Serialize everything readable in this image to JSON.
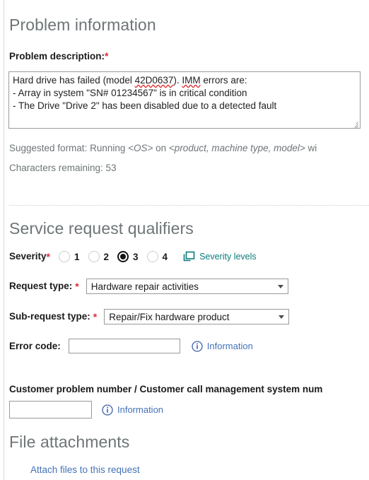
{
  "problem_information": {
    "heading": "Problem information",
    "description_label": "Problem description:",
    "required_marker": "*",
    "description_value_lines": [
      "Hard drive has failed (model 42D0637). IMM errors are:",
      "- Array in system \"SN# 01234567\" is in critical condition",
      "- The Drive \"Drive 2\" has been disabled due to a detected fault"
    ],
    "description_line1": {
      "before": "Hard drive has failed (model ",
      "misspell1": "42D0637",
      "middle": "). ",
      "misspell2": "IMM",
      "after": " errors are:"
    },
    "description_line2": "- Array in system \"SN# 01234567\" is in critical condition",
    "description_line3": "- The Drive \"Drive 2\" has been disabled due to a detected fault",
    "suggested_format": {
      "prefix": "Suggested format: Running ",
      "os_token": "<OS>",
      "middle": " on ",
      "product_token": "<product, machine type, model>",
      "suffix": " wi"
    },
    "characters_remaining": "Characters remaining: 53"
  },
  "service_request_qualifiers": {
    "heading": "Service request qualifiers",
    "severity_label": "Severity",
    "severity_required_marker": "*",
    "severity_options": [
      "1",
      "2",
      "3",
      "4"
    ],
    "severity_selected": "3",
    "severity_levels_link": "Severity levels",
    "severity_levels_icon": "popup-window-icon",
    "request_type_label": "Request type:",
    "request_type_required_marker": "*",
    "request_type_value": "Hardware repair activities",
    "sub_request_type_label": "Sub-request type:",
    "sub_request_type_required_marker": "*",
    "sub_request_type_value": "Repair/Fix hardware product",
    "error_code_label": "Error code:",
    "error_code_value": "",
    "error_code_placeholder": "",
    "error_code_info_link": "Information",
    "info_icon": "information-circle-icon"
  },
  "customer_problem": {
    "label": "Customer problem number / Customer call management system num",
    "value": "",
    "placeholder": "",
    "info_link": "Information"
  },
  "file_attachments": {
    "heading": "File attachments",
    "attach_link": "Attach files to this request"
  },
  "colors": {
    "heading_gray": "#6e7577",
    "required_red": "#e02b35",
    "link_blue": "#4472b8",
    "teal": "#0f7b7b",
    "border_gray": "#9a9a9a",
    "text_dark": "#1a1a1a"
  }
}
